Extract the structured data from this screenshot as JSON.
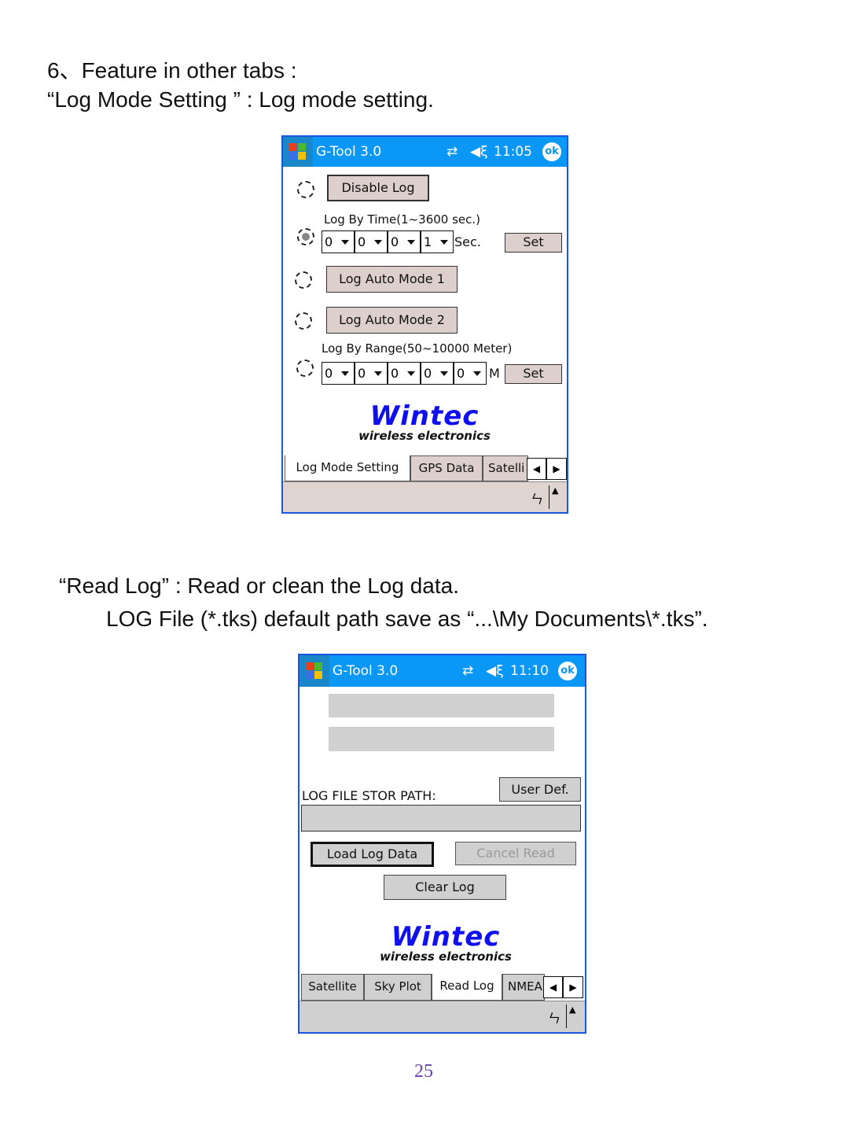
{
  "text": {
    "heading": "6、Feature in other tabs :",
    "log_mode_caption": "“Log Mode Setting ” : Log mode setting.",
    "read_log_caption": "“Read Log” : Read or clean the Log data.",
    "read_log_path_note": "LOG File (*.tks) default path save as “...\\My Documents\\*.tks”.",
    "page_number": "25"
  },
  "colors": {
    "title_bar": "#0a97f5",
    "border": "#1a56e0",
    "logo": "#1010ee",
    "page_number": "#6a3fb0"
  },
  "screen1": {
    "app_title": "G-Tool 3.0",
    "time": "11:05",
    "ok": "ok",
    "disable_log": "Disable Log",
    "log_by_time_label": "Log By Time(1~3600 sec.)",
    "time_digits": [
      "0",
      "0",
      "0",
      "1"
    ],
    "time_unit": "Sec.",
    "set": "Set",
    "auto_mode_1": "Log Auto Mode 1",
    "auto_mode_2": "Log Auto Mode 2",
    "log_by_range_label": "Log By Range(50~10000 Meter)",
    "range_digits": [
      "0",
      "0",
      "0",
      "0",
      "0"
    ],
    "range_unit": "M",
    "selected_mode": "Log By Time",
    "logo_main": "Wintec",
    "logo_sub": "wireless electronics",
    "tabs": [
      "Log Mode Setting",
      "GPS Data",
      "Satelli"
    ],
    "active_tab": "Log Mode Setting"
  },
  "screen2": {
    "app_title": "G-Tool 3.0",
    "time": "11:10",
    "ok": "ok",
    "path_label": "LOG FILE STOR PATH:",
    "user_def": "User Def.",
    "path_value": "",
    "load_log_data": "Load Log Data",
    "cancel_read": "Cancel Read",
    "clear_log": "Clear Log",
    "logo_main": "Wintec",
    "logo_sub": "wireless electronics",
    "tabs": [
      "Satellite",
      "Sky Plot",
      "Read Log",
      "NMEA"
    ],
    "active_tab": "Read Log"
  }
}
